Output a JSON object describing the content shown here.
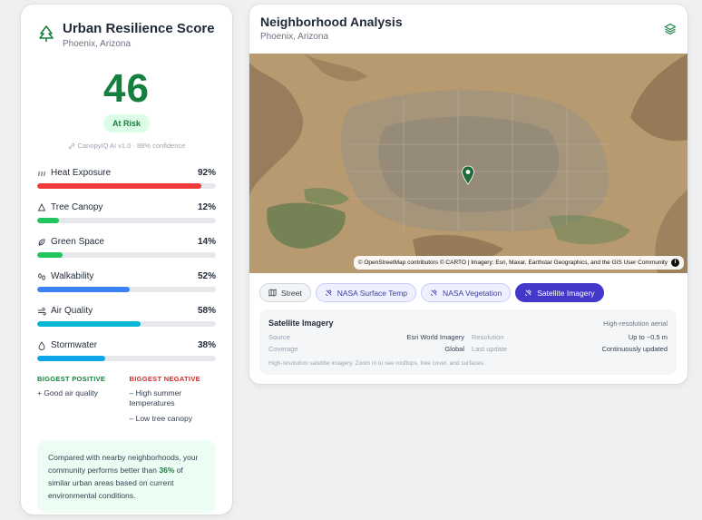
{
  "score_card": {
    "title": "Urban Resilience Score",
    "location": "Phoenix, Arizona",
    "score": "46",
    "status": "At Risk",
    "model_info": "CanopyIQ AI v1.0 · 88% confidence",
    "metrics": [
      {
        "label": "Heat Exposure",
        "value": "92%",
        "fraction": 0.92,
        "color": "#ef3b3b",
        "icon": "heat-icon"
      },
      {
        "label": "Tree Canopy",
        "value": "12%",
        "fraction": 0.12,
        "color": "#22c55e",
        "icon": "tree-icon"
      },
      {
        "label": "Green Space",
        "value": "14%",
        "fraction": 0.14,
        "color": "#22c55e",
        "icon": "leaf-icon"
      },
      {
        "label": "Walkability",
        "value": "52%",
        "fraction": 0.52,
        "color": "#3b82f6",
        "icon": "footprints-icon"
      },
      {
        "label": "Air Quality",
        "value": "58%",
        "fraction": 0.58,
        "color": "#06b6d4",
        "icon": "wind-icon"
      },
      {
        "label": "Stormwater",
        "value": "38%",
        "fraction": 0.38,
        "color": "#0ea5e9",
        "icon": "droplet-icon"
      }
    ],
    "biggest_positive": {
      "heading": "BIGGEST POSITIVE",
      "items": [
        "+ Good air quality"
      ]
    },
    "biggest_negative": {
      "heading": "BIGGEST NEGATIVE",
      "items": [
        "– High summer temperatures",
        "– Low tree canopy"
      ]
    },
    "comparison": {
      "before": "Compared with nearby neighborhoods, your community performs better than ",
      "percent": "36%",
      "after": " of similar urban areas based on current environmental conditions."
    }
  },
  "analysis": {
    "title": "Neighborhood Analysis",
    "location": "Phoenix, Arizona",
    "map_attribution": "© OpenStreetMap contributors © CARTO | Imagery: Esri, Maxar, Earthstar Geographics, and the GIS User Community",
    "info_symbol": "i",
    "layers": [
      {
        "label": "Street",
        "style": "plain",
        "icon": "map-icon"
      },
      {
        "label": "NASA Surface Temp",
        "style": "nasa",
        "icon": "satellite-icon"
      },
      {
        "label": "NASA Vegetation",
        "style": "nasa",
        "icon": "satellite-icon"
      },
      {
        "label": "Satellite Imagery",
        "style": "active",
        "icon": "satellite-icon"
      }
    ],
    "panel": {
      "title": "Satellite Imagery",
      "tag": "High-resolution aerial",
      "rows_left": [
        {
          "key": "Source",
          "value": "Esri World Imagery"
        },
        {
          "key": "Coverage",
          "value": "Global"
        }
      ],
      "rows_right": [
        {
          "key": "Resolution",
          "value": "Up to ~0.5 m"
        },
        {
          "key": "Last update",
          "value": "Continuously updated"
        }
      ],
      "note": "High-resolution satellite imagery. Zoom in to see rooftops, tree cover, and surfaces."
    }
  }
}
